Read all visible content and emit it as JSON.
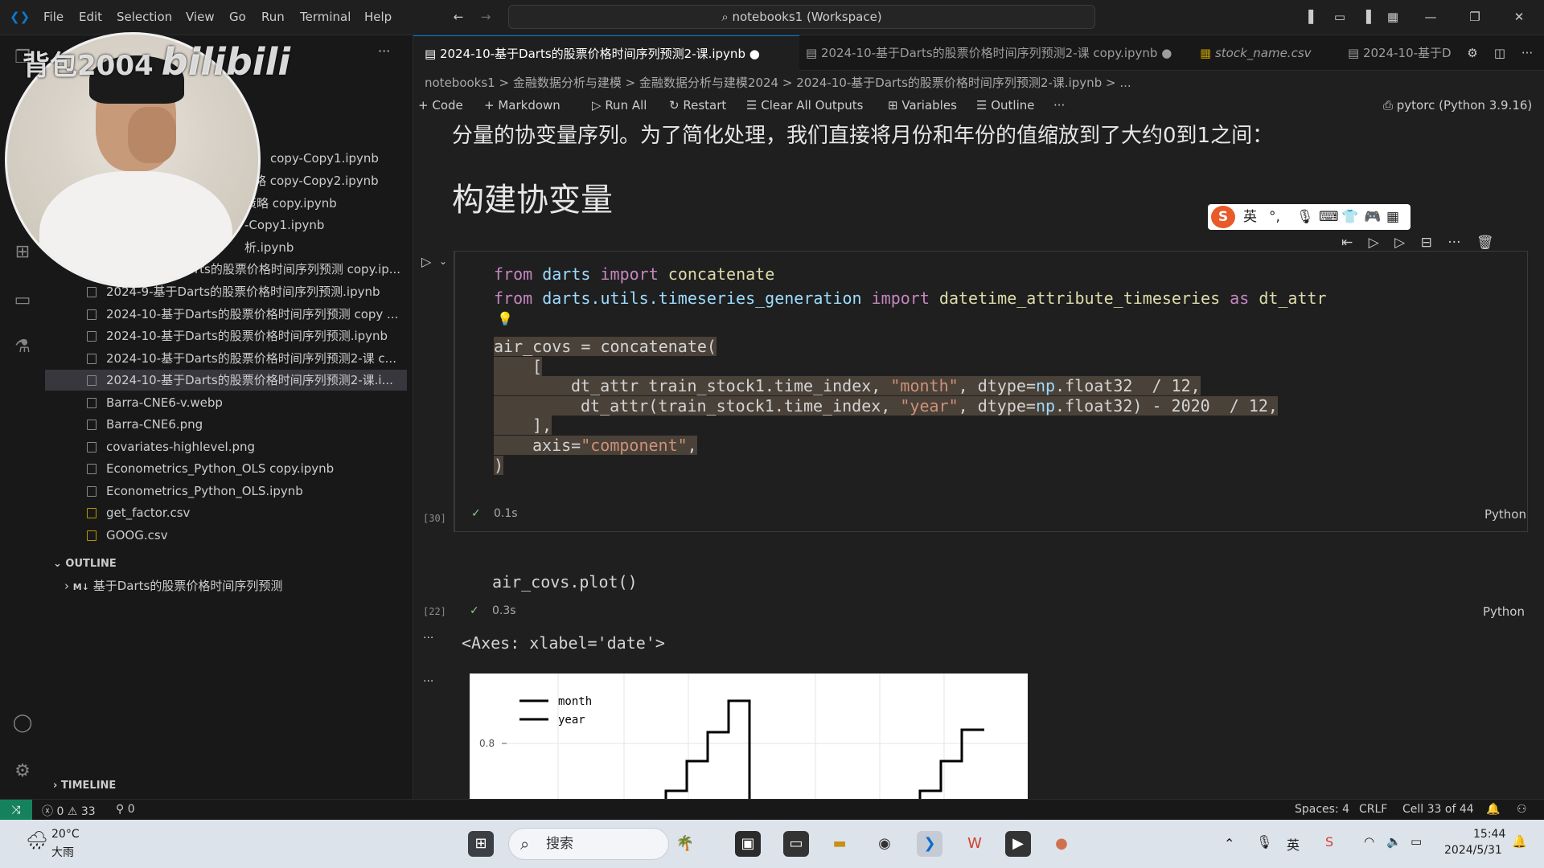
{
  "menu": [
    "File",
    "Edit",
    "Selection",
    "View",
    "Go",
    "Run",
    "Terminal",
    "Help"
  ],
  "command_center": "notebooks1 (Workspace)",
  "watermark": {
    "user": "背包2004",
    "brand": "bilibili"
  },
  "explorer": {
    "files": [
      "copy-Copy1.ipynb",
      "略 copy-Copy2.ipynb",
      "策略 copy.ipynb",
      "-Copy1.ipynb",
      "析.ipynb",
      "rts的股票价格时间序列预测 copy.ip...",
      "2024-9-基于Darts的股票价格时间序列预测.ipynb",
      "2024-10-基于Darts的股票价格时间序列预测 copy ...",
      "2024-10-基于Darts的股票价格时间序列预测.ipynb",
      "2024-10-基于Darts的股票价格时间序列预测2-课 c...",
      "2024-10-基于Darts的股票价格时间序列预测2-课.i...",
      "Barra-CNE6-v.webp",
      "Barra-CNE6.png",
      "covariates-highlevel.png",
      "Econometrics_Python_OLS copy.ipynb",
      "Econometrics_Python_OLS.ipynb",
      "get_factor.csv",
      "GOOG.csv"
    ],
    "outline_header": "OUTLINE",
    "outline_item": "基于Darts的股票价格时间序列预测",
    "outline_badge": "M↓",
    "timeline_header": "TIMELINE"
  },
  "tabs": [
    "2024-10-基于Darts的股票价格时间序列预测2-课.ipynb",
    "2024-10-基于Darts的股票价格时间序列预测2-课 copy.ipynb",
    "stock_name.csv",
    "2024-10-基于D"
  ],
  "breadcrumb": "notebooks1 > 金融数据分析与建模 > 金融数据分析与建模2024 > 2024-10-基于Darts的股票价格时间序列预测2-课.ipynb > ...",
  "nb_toolbar": {
    "code": "Code",
    "markdown": "Markdown",
    "run_all": "Run All",
    "restart": "Restart",
    "clear": "Clear All Outputs",
    "variables": "Variables",
    "outline": "Outline",
    "more": "···",
    "kernel": "pytorc (Python 3.9.16)"
  },
  "markdown": {
    "text": "分量的协变量序列。为了简化处理，我们直接将月份和年份的值缩放到了大约0到1之间：",
    "heading": "构建协变量"
  },
  "ime": {
    "mode": "英",
    "punct": "°,"
  },
  "cell1": {
    "exec_count": "[30]",
    "time": "0.1s",
    "lang": "Python",
    "lines": {
      "l1": [
        "from",
        "darts",
        "import",
        "concatenate"
      ],
      "l2": [
        "from",
        "darts.utils.timeseries_generation",
        "import",
        "datetime_attribute_timeseries",
        "as",
        "dt_attr"
      ],
      "l3": "air_covs = concatenate(",
      "l4": "[",
      "l5a": "dt_attr train_stock1.time_index, ",
      "l5b": "\"month\"",
      "l5c": ", dtype=",
      "l5d": "np",
      "l5e": ".float32  / 12,",
      "l6a": "dt_attr(train_stock1.time_index, ",
      "l6b": "\"year\"",
      "l6c": ", dtype=",
      "l6d": "np",
      "l6e": ".float32) - 2020  / 12,",
      "l7": "],",
      "l8a": "axis=",
      "l8b": "\"component\"",
      "l8c": ",",
      "l9": ")"
    }
  },
  "cell2": {
    "exec_count": "[22]",
    "code": "air_covs.plot()",
    "time": "0.3s",
    "lang": "Python",
    "output_text": "<Axes: xlabel='date'>"
  },
  "chart_data": {
    "type": "line",
    "series": [
      {
        "name": "month",
        "color": "#000000"
      },
      {
        "name": "year",
        "color": "#000000"
      }
    ],
    "ytick_labels": [
      "0.8"
    ],
    "legend": "top-left",
    "grid": true
  },
  "status": {
    "errors": "0",
    "warnings": "33",
    "ports": "0",
    "spaces": "Spaces: 4",
    "eol": "CRLF",
    "cell": "Cell 33 of 44"
  },
  "taskbar": {
    "weather_temp": "20°C",
    "weather_desc": "大雨",
    "search": "搜索",
    "time": "15:44",
    "date": "2024/5/31"
  }
}
